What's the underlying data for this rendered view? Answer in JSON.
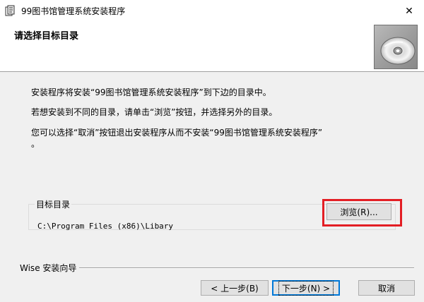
{
  "window": {
    "title": "99图书馆管理系统安装程序",
    "close_glyph": "✕"
  },
  "header": {
    "title": "请选择目标目录",
    "image_icon": "cd-disc-icon"
  },
  "body": {
    "line1": "安装程序将安装“99图书馆管理系统安装程序”到下边的目录中。",
    "line2": "若想安装到不同的目录，请单击“浏览”按钮，并选择另外的目录。",
    "line3a": "您可以选择“取消”按钮退出安装程序从而不安装“99图书馆管理系统安装程序”",
    "line3b": "。"
  },
  "target": {
    "group_label": "目标目录",
    "path": "C:\\Program Files (x86)\\Libary",
    "browse_label": "浏览(R)..."
  },
  "footer": {
    "wizard_label": "Wise 安装向导",
    "back_label": "< 上一步(B)",
    "next_label": "下一步(N) >",
    "cancel_label": "取消"
  },
  "colors": {
    "highlight": "#e31e24",
    "default_button_border": "#0078d7"
  }
}
